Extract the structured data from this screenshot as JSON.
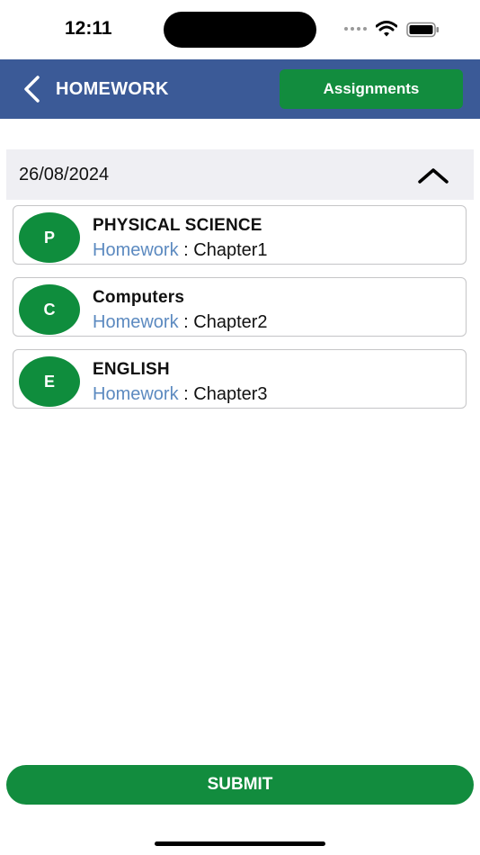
{
  "status_bar": {
    "time": "12:11"
  },
  "header": {
    "title": "HOMEWORK",
    "assignments_label": "Assignments"
  },
  "date_section": {
    "date": "26/08/2024"
  },
  "homework": [
    {
      "initial": "P",
      "subject": "PHYSICAL SCIENCE",
      "label": "Homework",
      "separator": " : ",
      "chapter": "Chapter1"
    },
    {
      "initial": "C",
      "subject": "Computers",
      "label": "Homework",
      "separator": " : ",
      "chapter": "Chapter2"
    },
    {
      "initial": "E",
      "subject": "ENGLISH",
      "label": "Homework",
      "separator": " : ",
      "chapter": "Chapter3"
    }
  ],
  "footer": {
    "submit_label": "SUBMIT"
  },
  "colors": {
    "header_bg": "#3b5a97",
    "accent_green": "#128c3e",
    "link_blue": "#5c8ac0"
  }
}
